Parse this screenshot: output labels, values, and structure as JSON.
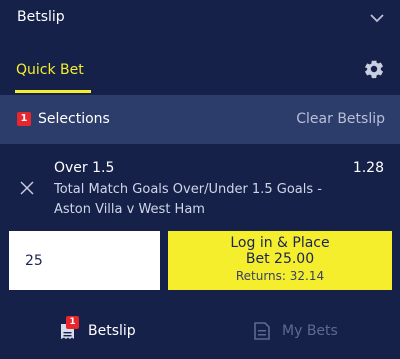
{
  "header": {
    "title": "Betslip",
    "collapse_icon": "chevron-down-icon"
  },
  "quick_bet": {
    "label": "Quick Bet",
    "settings_icon": "gear-icon"
  },
  "selections": {
    "count": "1",
    "label": "Selections",
    "clear_label": "Clear Betslip"
  },
  "bet": {
    "selection": "Over 1.5",
    "odds": "1.28",
    "market": "Total Match Goals Over/Under 1.5 Goals - Aston Villa v West Ham",
    "remove_icon": "close-icon"
  },
  "stake": {
    "value": "25"
  },
  "place_button": {
    "line1": "Log in & Place",
    "line2": "Bet 25.00",
    "returns": "Returns:  32.14"
  },
  "footer": {
    "betslip_label": "Betslip",
    "betslip_count": "1",
    "betslip_icon": "betslip-icon",
    "mybets_label": "My Bets",
    "mybets_icon": "my-bets-icon"
  },
  "colors": {
    "background": "#16214a",
    "selections_bar": "#2c3c6b",
    "accent_yellow": "#f5ee2c",
    "badge_red": "#e8262e",
    "muted_text": "#5e6991"
  }
}
